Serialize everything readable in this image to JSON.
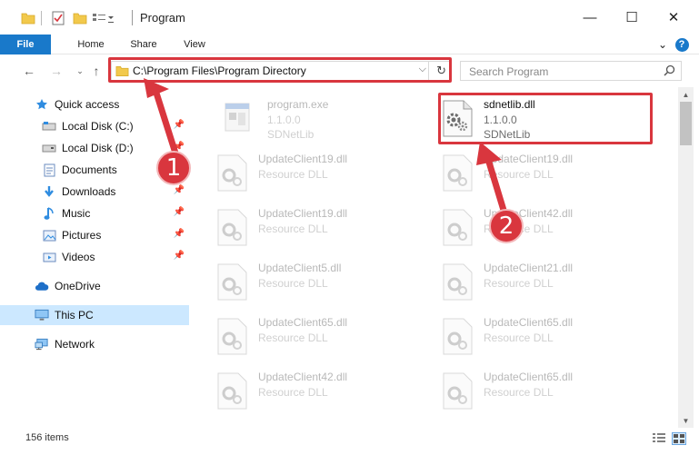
{
  "window": {
    "title": "Program",
    "minimize_glyph": "—",
    "maximize_glyph": "☐",
    "close_glyph": "✕"
  },
  "ribbon": {
    "tabs": [
      {
        "label": "File"
      },
      {
        "label": "Home"
      },
      {
        "label": "Share"
      },
      {
        "label": "View"
      }
    ],
    "help_glyph": "?"
  },
  "address_bar": {
    "path": "C:\\Program Files\\Program Directory",
    "dropdown_glyph": "⌵",
    "refresh_glyph": "↻"
  },
  "search": {
    "placeholder": "Search Program"
  },
  "sidebar": {
    "items": [
      {
        "label": "Quick access",
        "icon": "star-icon"
      },
      {
        "label": "Local Disk (C:)",
        "icon": "drive-icon",
        "pinned": true
      },
      {
        "label": "Local Disk (D:)",
        "icon": "drive-icon",
        "pinned": true
      },
      {
        "label": "Documents",
        "icon": "documents-icon",
        "pinned": true
      },
      {
        "label": "Downloads",
        "icon": "download-icon",
        "pinned": true
      },
      {
        "label": "Music",
        "icon": "music-icon",
        "pinned": true
      },
      {
        "label": "Pictures",
        "icon": "pictures-icon",
        "pinned": true
      },
      {
        "label": "Videos",
        "icon": "videos-icon",
        "pinned": true
      },
      {
        "label": "OneDrive",
        "icon": "cloud-icon"
      },
      {
        "label": "This PC",
        "icon": "computer-icon",
        "selected": true
      },
      {
        "label": "Network",
        "icon": "network-icon"
      }
    ]
  },
  "files": [
    {
      "name": "program.exe",
      "line2": "1.1.0.0",
      "line3": "SDNetLib",
      "type": "exe",
      "highlighted": false
    },
    {
      "name": "sdnetlib.dll",
      "line2": "1.1.0.0",
      "line3": "SDNetLib",
      "type": "dll-gear",
      "highlighted": true
    },
    {
      "name": "UpdateClient19.dll",
      "line2": "Resource DLL",
      "type": "dll"
    },
    {
      "name": "UpdateClient19.dll",
      "line2": "Resource DLL",
      "type": "dll"
    },
    {
      "name": "UpdateClient19.dll",
      "line2": "Resource DLL",
      "type": "dll"
    },
    {
      "name": "UpdateClient42.dll",
      "line2": "Resource DLL",
      "type": "dll"
    },
    {
      "name": "UpdateClient5.dll",
      "line2": "Resource DLL",
      "type": "dll"
    },
    {
      "name": "UpdateClient21.dll",
      "line2": "Resource DLL",
      "type": "dll"
    },
    {
      "name": "UpdateClient65.dll",
      "line2": "Resource DLL",
      "type": "dll"
    },
    {
      "name": "UpdateClient65.dll",
      "line2": "Resource DLL",
      "type": "dll"
    },
    {
      "name": "UpdateClient42.dll",
      "line2": "Resource DLL",
      "type": "dll"
    },
    {
      "name": "UpdateClient65.dll",
      "line2": "Resource DLL",
      "type": "dll"
    }
  ],
  "status": {
    "item_count": "156 items"
  },
  "annotations": {
    "callout_1": "1",
    "callout_2": "2",
    "highlight_color": "#d9363e"
  },
  "colors": {
    "accent": "#1979ca",
    "selected_bg": "#cce8ff"
  }
}
